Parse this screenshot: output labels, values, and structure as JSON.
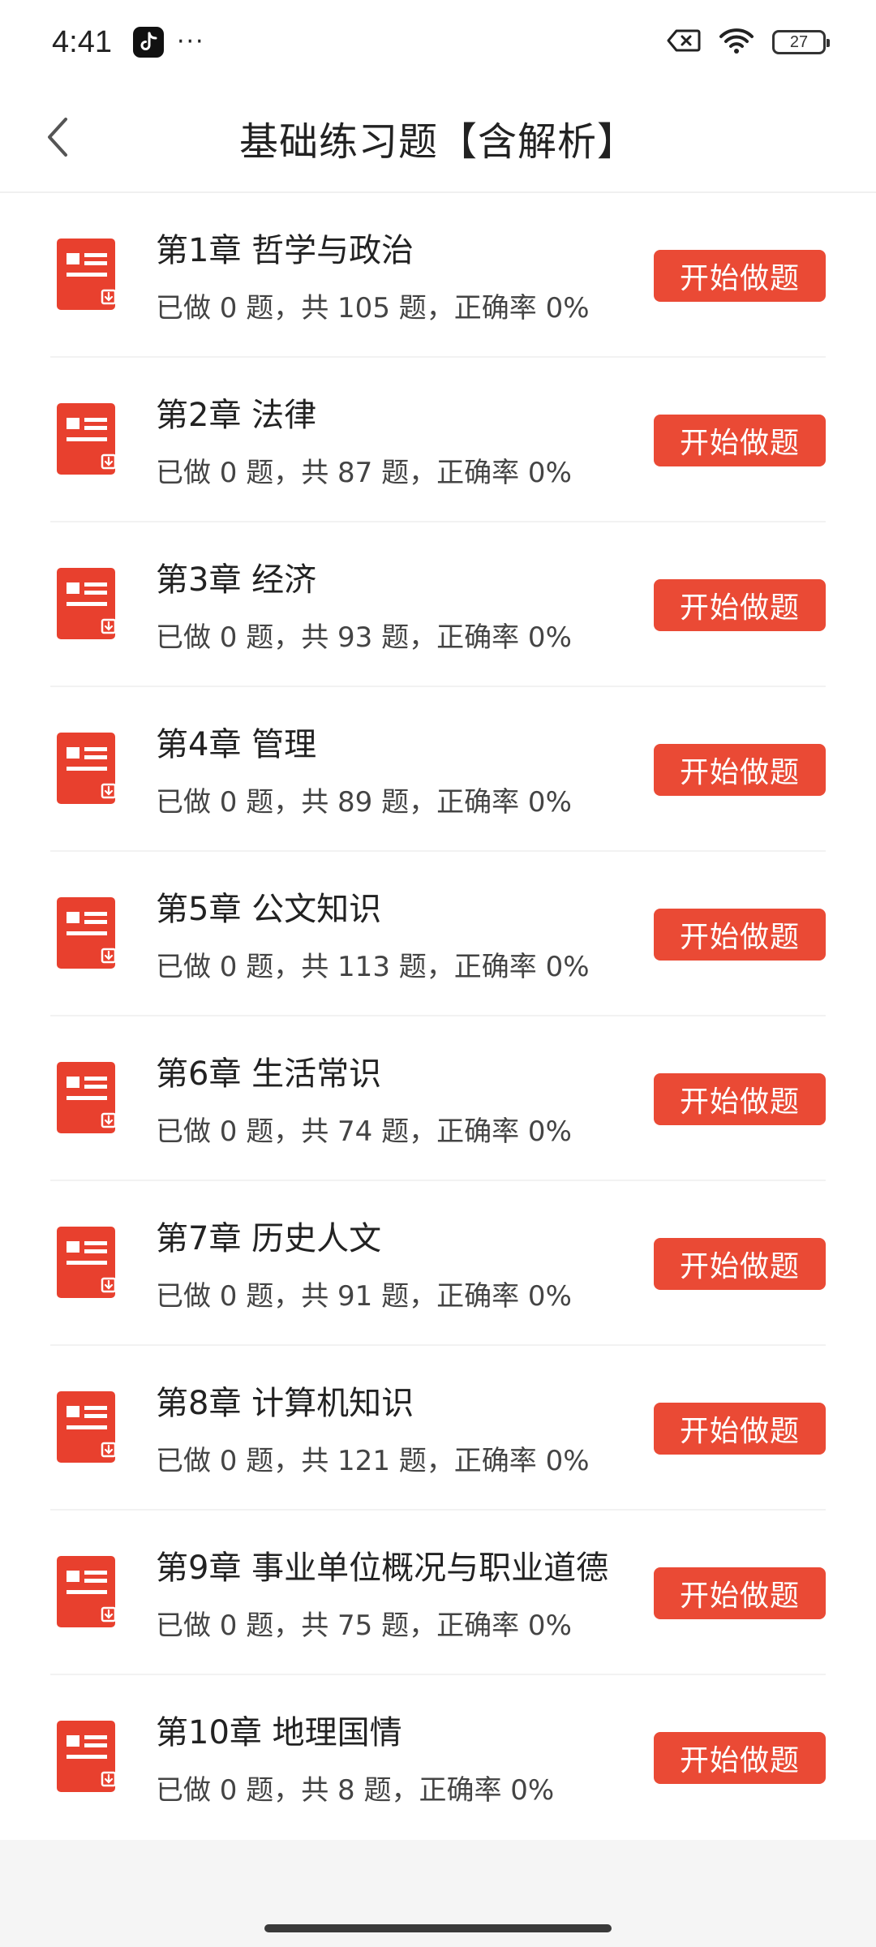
{
  "status_bar": {
    "time": "4:41",
    "more": "···",
    "battery": "27",
    "icons": [
      "tiktok-icon",
      "sim-off-icon",
      "wifi-icon",
      "battery-icon"
    ]
  },
  "header": {
    "title": "基础练习题【含解析】",
    "back_icon": "chevron-left-icon"
  },
  "accent_color": "#ea4a35",
  "chapters": [
    {
      "title": "第1章 哲学与政治",
      "stats": "已做 0 题，共 105 题，正确率 0%",
      "button": "开始做题"
    },
    {
      "title": "第2章 法律",
      "stats": "已做 0 题，共 87 题，正确率 0%",
      "button": "开始做题"
    },
    {
      "title": "第3章 经济",
      "stats": "已做 0 题，共 93 题，正确率 0%",
      "button": "开始做题"
    },
    {
      "title": "第4章 管理",
      "stats": "已做 0 题，共 89 题，正确率 0%",
      "button": "开始做题"
    },
    {
      "title": "第5章 公文知识",
      "stats": "已做 0 题，共 113 题，正确率 0%",
      "button": "开始做题"
    },
    {
      "title": "第6章 生活常识",
      "stats": "已做 0 题，共 74 题，正确率 0%",
      "button": "开始做题"
    },
    {
      "title": "第7章 历史人文",
      "stats": "已做 0 题，共 91 题，正确率 0%",
      "button": "开始做题"
    },
    {
      "title": "第8章 计算机知识",
      "stats": "已做 0 题，共 121 题，正确率 0%",
      "button": "开始做题"
    },
    {
      "title": "第9章 事业单位概况与职业道德",
      "stats": "已做 0 题，共 75 题，正确率 0%",
      "button": "开始做题"
    },
    {
      "title": "第10章 地理国情",
      "stats": "已做 0 题，共 8 题，正确率 0%",
      "button": "开始做题"
    }
  ]
}
